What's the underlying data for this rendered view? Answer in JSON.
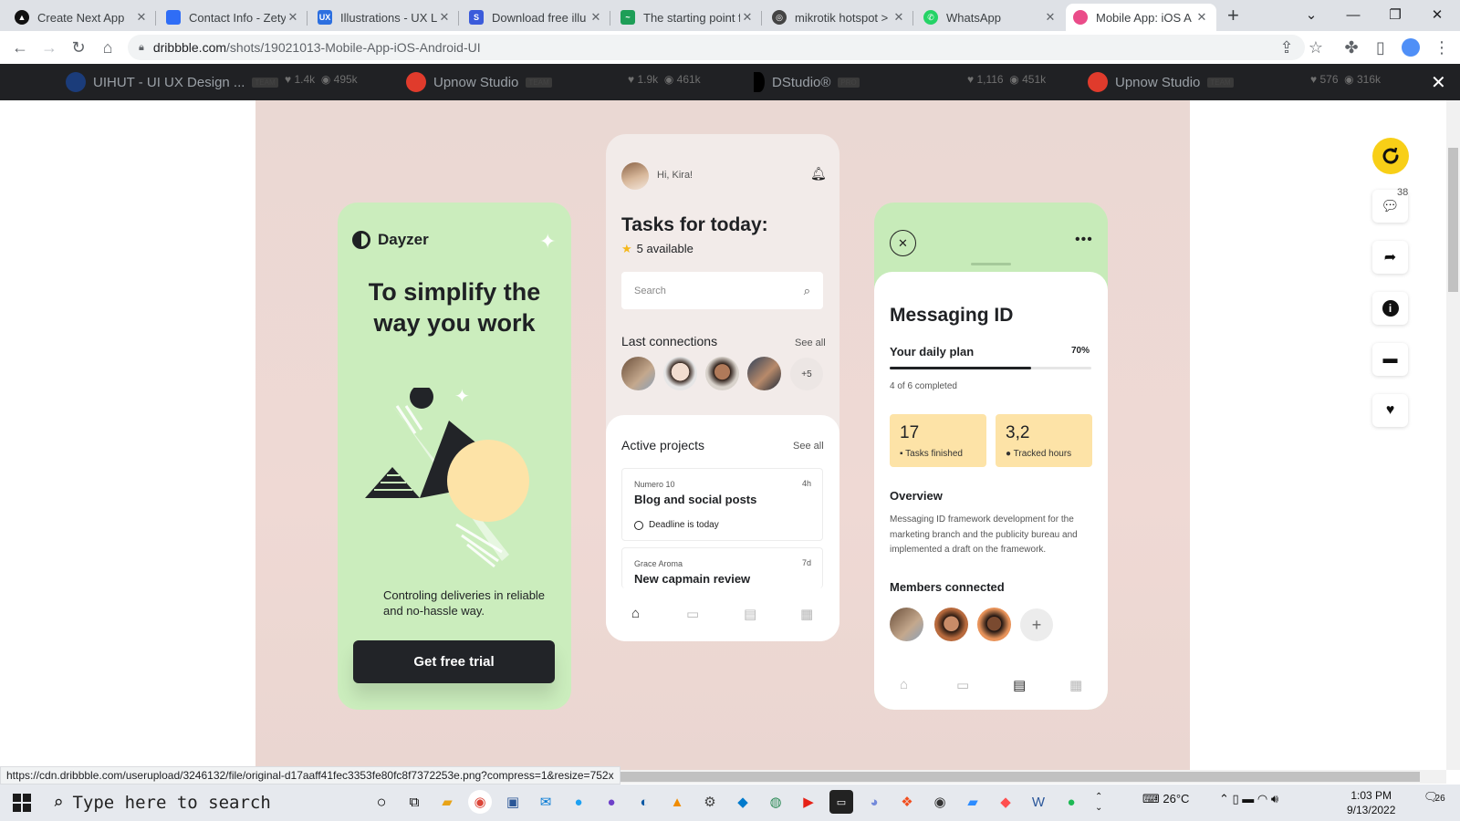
{
  "browser": {
    "tabs": [
      {
        "title": "Create Next App",
        "active": false
      },
      {
        "title": "Contact Info - Zety",
        "active": false
      },
      {
        "title": "Illustrations - UX L",
        "active": false
      },
      {
        "title": "Download free illu",
        "active": false
      },
      {
        "title": "The starting point f",
        "active": false
      },
      {
        "title": "mikrotik hotspot >",
        "active": false
      },
      {
        "title": "WhatsApp",
        "active": false
      },
      {
        "title": "Mobile App: iOS A",
        "active": true
      }
    ],
    "url_host": "dribbble.com",
    "url_path": "/shots/19021013-Mobile-App-iOS-Android-UI",
    "status_url": "https://cdn.dribbble.com/userupload/3246132/file/original-d17aaff41fec3353fe80fc8f7372253e.png?compress=1&resize=752x"
  },
  "shots_bar": [
    {
      "name": "UIHUT - UI UX Design ...",
      "badge": "TEAM",
      "likes": "1.4k",
      "views": "495k"
    },
    {
      "name": "Upnow Studio",
      "badge": "TEAM",
      "likes": "1.9k",
      "views": "461k"
    },
    {
      "name": "DStudio®",
      "badge": "PRO",
      "likes": "1,116",
      "views": "451k"
    },
    {
      "name": "Upnow Studio",
      "badge": "TEAM",
      "likes": "576",
      "views": "316k"
    }
  ],
  "screen1": {
    "brand": "Dayzer",
    "title": "To simplify the way you work",
    "subtitle": "Controling deliveries in reliable and no-hassle way.",
    "cta": "Get free trial"
  },
  "screen2": {
    "greeting": "Hi, Kira!",
    "title": "Tasks for today:",
    "available": "5 available",
    "search_placeholder": "Search",
    "last_connections": "Last connections",
    "see_all": "See all",
    "more_count": "+5",
    "active_projects": "Active projects",
    "projects": [
      {
        "by": "Numero 10",
        "name": "Blog and social posts",
        "duration": "4h",
        "deadline": "Deadline is today"
      },
      {
        "by": "Grace Aroma",
        "name": "New capmain review",
        "duration": "7d"
      }
    ]
  },
  "screen3": {
    "title": "Messaging ID",
    "plan_label": "Your daily plan",
    "plan_percent": "70%",
    "plan_progress": 0.7,
    "completed": "4 of 6 completed",
    "stats": [
      {
        "value": "17",
        "label": "Tasks finished"
      },
      {
        "value": "3,2",
        "label": "Tracked hours"
      }
    ],
    "overview_heading": "Overview",
    "overview_text": "Messaging ID framework development for the marketing branch and the publicity bureau and implemented a draft on the framework.",
    "members_heading": "Members connected"
  },
  "rail": {
    "comments_count": "38"
  },
  "taskbar": {
    "search_placeholder": "Type here to search",
    "temperature": "26°C",
    "time": "1:03 PM",
    "date": "9/13/2022",
    "notifications": "26"
  },
  "colors": {
    "green_screen": "#cbedbd",
    "pink_bg": "#ead8d3",
    "stat_yellow": "#fde3a7",
    "dark": "#1f2124"
  }
}
